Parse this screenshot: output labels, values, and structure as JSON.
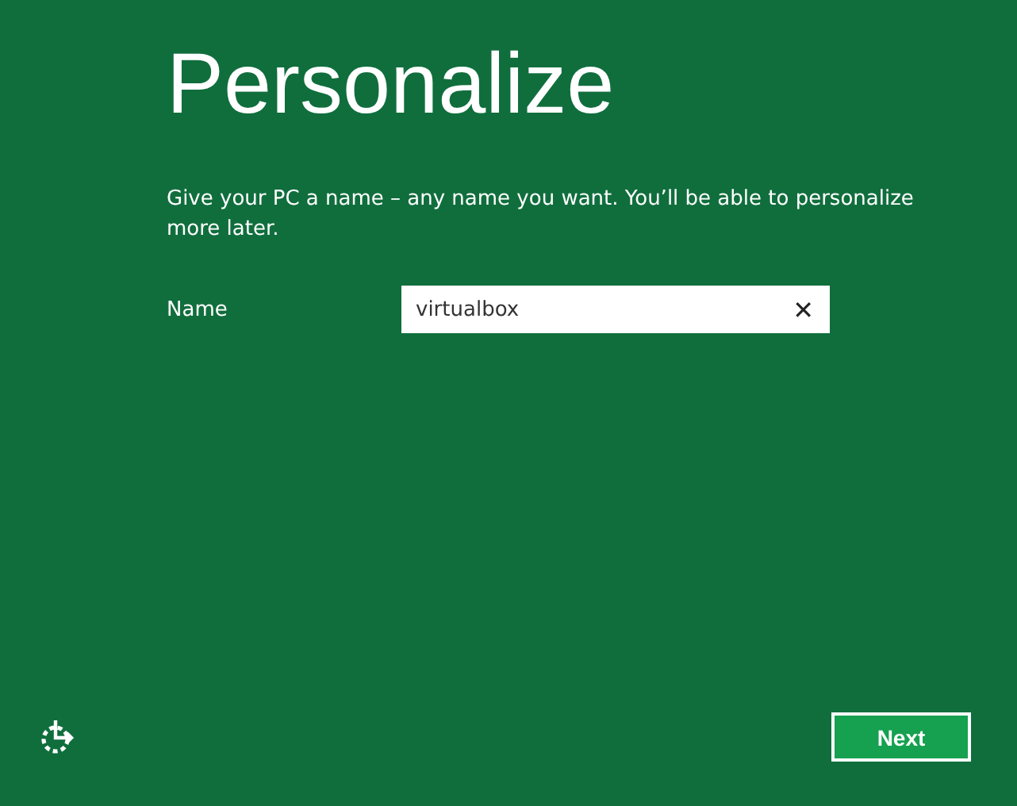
{
  "title": "Personalize",
  "description": "Give your PC a name – any name you want. You’ll be able to personalize more later.",
  "name_field": {
    "label": "Name",
    "value": "virtualbox",
    "clear": "✕"
  },
  "buttons": [
    {
      "label": "Next"
    }
  ]
}
